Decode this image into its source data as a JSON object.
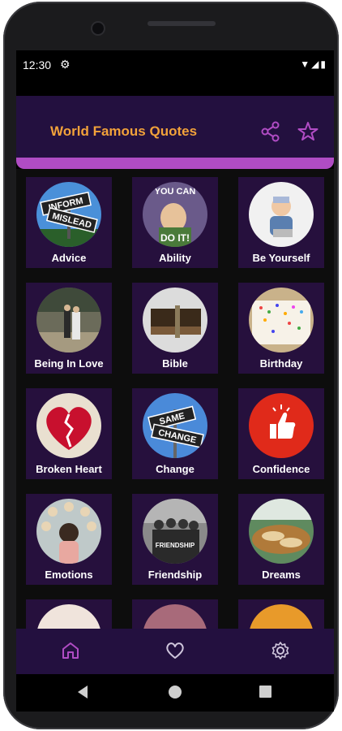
{
  "status_bar": {
    "time": "12:30",
    "gear_icon": "settings-gear-icon",
    "icons": [
      "wifi-icon",
      "signal-icon",
      "battery-icon"
    ]
  },
  "app_bar": {
    "title": "World Famous Quotes",
    "share_icon": "share-icon",
    "favorite_icon": "star-icon"
  },
  "colors": {
    "appbar": "#23103f",
    "accent": "#b04cc4",
    "title": "#f2a23a",
    "card": "#26103d"
  },
  "categories": [
    {
      "label": "Advice",
      "circle_text": [
        "INFORM",
        "MISLEAD"
      ]
    },
    {
      "label": "Ability",
      "circle_text": [
        "YOU CAN",
        "DO IT!"
      ]
    },
    {
      "label": "Be Yourself",
      "circle_text": []
    },
    {
      "label": "Being In Love",
      "circle_text": []
    },
    {
      "label": "Bible",
      "circle_text": []
    },
    {
      "label": "Birthday",
      "circle_text": []
    },
    {
      "label": "Broken Heart",
      "circle_text": []
    },
    {
      "label": "Change",
      "circle_text": [
        "SAME",
        "CHANGE"
      ]
    },
    {
      "label": "Confidence",
      "circle_text": []
    },
    {
      "label": "Emotions",
      "circle_text": []
    },
    {
      "label": "Friendship",
      "circle_text": [
        "FRIENDSHIP"
      ]
    },
    {
      "label": "Dreams",
      "circle_text": []
    }
  ],
  "bottom_nav": {
    "items": [
      "home-icon",
      "heart-icon",
      "settings-icon"
    ]
  }
}
